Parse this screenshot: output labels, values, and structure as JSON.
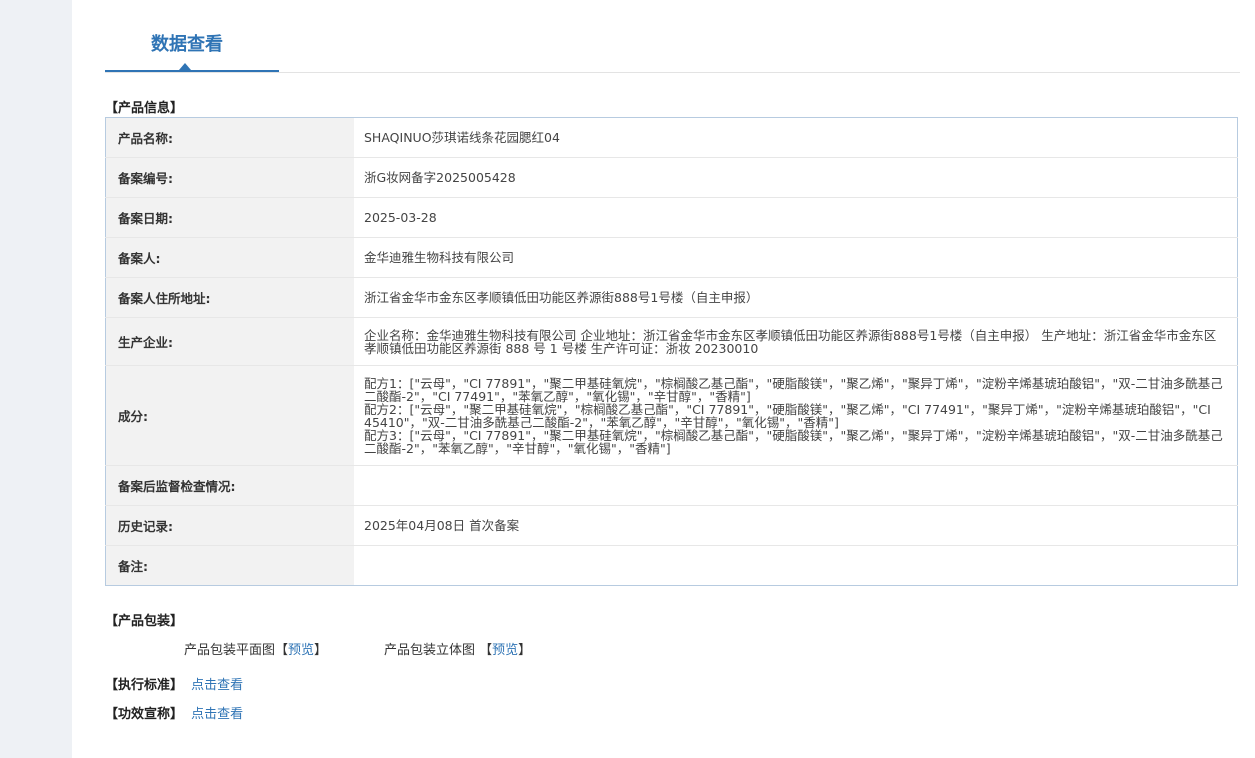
{
  "tab": {
    "title": "数据查看"
  },
  "sections": {
    "product_info": "【产品信息】",
    "packaging": "【产品包装】",
    "standard": "【执行标准】",
    "efficacy": "【功效宣称】"
  },
  "product_info": {
    "name_label": "产品名称:",
    "name_value": "SHAQINUO莎琪诺线条花园腮红04",
    "reg_no_label": "备案编号:",
    "reg_no_value": "浙G妆网备字2025005428",
    "reg_date_label": "备案日期:",
    "reg_date_value": "2025-03-28",
    "registrant_label": "备案人:",
    "registrant_value": "金华迪雅生物科技有限公司",
    "address_label": "备案人住所地址:",
    "address_value": "浙江省金华市金东区孝顺镇低田功能区养源街888号1号楼（自主申报）",
    "manufacturer_label": "生产企业:",
    "manufacturer_value": "企业名称：金华迪雅生物科技有限公司 企业地址：浙江省金华市金东区孝顺镇低田功能区养源街888号1号楼（自主申报） 生产地址：浙江省金华市金东区孝顺镇低田功能区养源街 888 号 1 号楼 生产许可证：浙妆 20230010",
    "ingredients_label": "成分:",
    "ingredients_1": "配方1：[\"云母\"，\"CI 77891\"，\"聚二甲基硅氧烷\"，\"棕榈酸乙基己酯\"，\"硬脂酸镁\"，\"聚乙烯\"，\"聚异丁烯\"，\"淀粉辛烯基琥珀酸铝\"，\"双-二甘油多酰基己二酸酯-2\"，\"CI 77491\"，\"苯氧乙醇\"，\"氧化锡\"，\"辛甘醇\"，\"香精\"]",
    "ingredients_2": "配方2：[\"云母\"，\"聚二甲基硅氧烷\"，\"棕榈酸乙基己酯\"，\"CI 77891\"，\"硬脂酸镁\"，\"聚乙烯\"，\"CI 77491\"，\"聚异丁烯\"，\"淀粉辛烯基琥珀酸铝\"，\"CI 45410\"，\"双-二甘油多酰基己二酸酯-2\"，\"苯氧乙醇\"，\"辛甘醇\"，\"氧化锡\"，\"香精\"]",
    "ingredients_3": "配方3：[\"云母\"，\"CI 77891\"，\"聚二甲基硅氧烷\"，\"棕榈酸乙基己酯\"，\"硬脂酸镁\"，\"聚乙烯\"，\"聚异丁烯\"，\"淀粉辛烯基琥珀酸铝\"，\"双-二甘油多酰基己二酸酯-2\"，\"苯氧乙醇\"，\"辛甘醇\"，\"氧化锡\"，\"香精\"]",
    "inspection_label": "备案后监督检查情况:",
    "inspection_value": "",
    "history_label": "历史记录:",
    "history_value": "2025年04月08日 首次备案",
    "remark_label": "备注:",
    "remark_value": ""
  },
  "packaging": {
    "flat_label": "产品包装平面图【",
    "flat_link": "预览",
    "flat_close": "】",
    "solid_label": "产品包装立体图 【",
    "solid_link": "预览",
    "solid_close": "】"
  },
  "links": {
    "standard_link": "点击查看",
    "efficacy_link": "点击查看"
  },
  "colors": {
    "accent": "#2f74b5",
    "label_bg": "#f2f2f2",
    "page_bg": "#eef1f5",
    "table_border": "#b7cbe0"
  }
}
